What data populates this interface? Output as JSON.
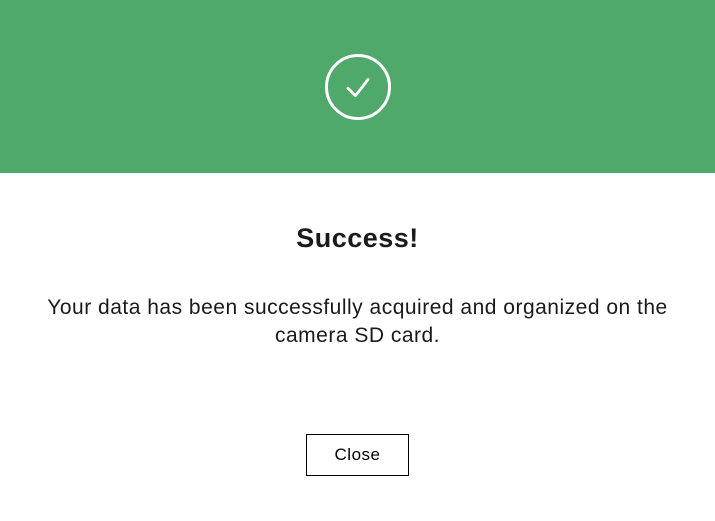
{
  "dialog": {
    "title": "Success!",
    "message": "Your data has been successfully acquired and organized on the camera SD card.",
    "close_label": "Close"
  }
}
